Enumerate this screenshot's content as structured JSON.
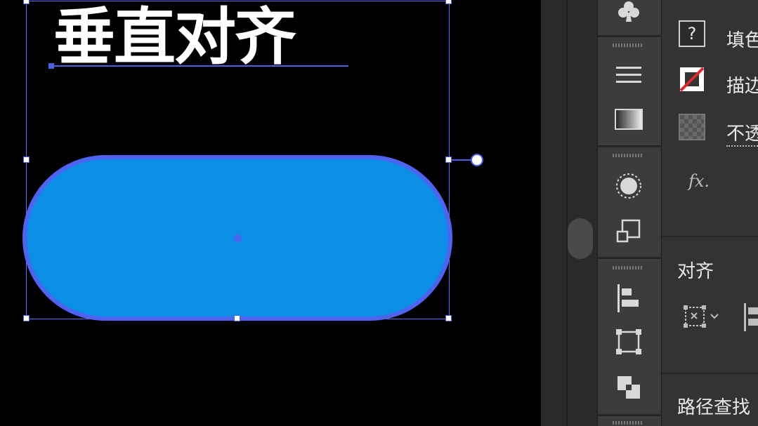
{
  "canvas": {
    "title_text": "垂直对齐",
    "shape": {
      "type": "rounded-rectangle",
      "fill_color": "#0a8ee6",
      "stroke_color": "#4e63f0"
    },
    "selection_color": "#4d5fe6"
  },
  "toolstrip": {
    "icons": [
      "club-icon",
      "menu-lines-icon",
      "gradient-icon",
      "circle-dashed-icon",
      "transform-icon",
      "align-left-icon",
      "distribute-icon",
      "pathfinder-icon"
    ]
  },
  "panel": {
    "fill_row": {
      "icon": "question-swatch-icon",
      "label": "填色"
    },
    "stroke_row": {
      "icon": "no-stroke-swatch-icon",
      "label": "描边"
    },
    "opacity_row": {
      "icon": "transparency-checker-icon",
      "label": "不透"
    },
    "fx_label": "fx.",
    "align_section": {
      "title": "对齐"
    },
    "pathfinder_section": {
      "title": "路径查找"
    }
  },
  "colors": {
    "canvas_bg": "#000000",
    "panel_bg": "#333333",
    "strip_bg": "#3c3c3c",
    "accent": "#4d5fe6"
  }
}
